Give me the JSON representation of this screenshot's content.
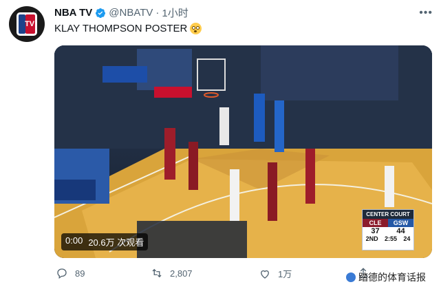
{
  "account": {
    "name": "NBA TV",
    "handle": "@NBATV",
    "separator": "·",
    "time": "1小时",
    "avatar_text": "TV"
  },
  "tweet": {
    "text": "KLAY THOMPSON POSTER"
  },
  "video": {
    "elapsed": "0:00",
    "views": "20.6万 次观看"
  },
  "scoreboard": {
    "header": "CENTER COURT",
    "team_away": "CLE",
    "team_home": "GSW",
    "score_away": "37",
    "score_home": "44",
    "period": "2ND",
    "clock": "2:55",
    "shot_clock": "24"
  },
  "actions": {
    "replies": "89",
    "retweets": "2,807",
    "likes": "1万"
  },
  "watermark": {
    "text": "踏德的体育话报"
  },
  "colors": {
    "verified": "#1d9bf0",
    "muted": "#536471",
    "court": "#e8b84a"
  }
}
